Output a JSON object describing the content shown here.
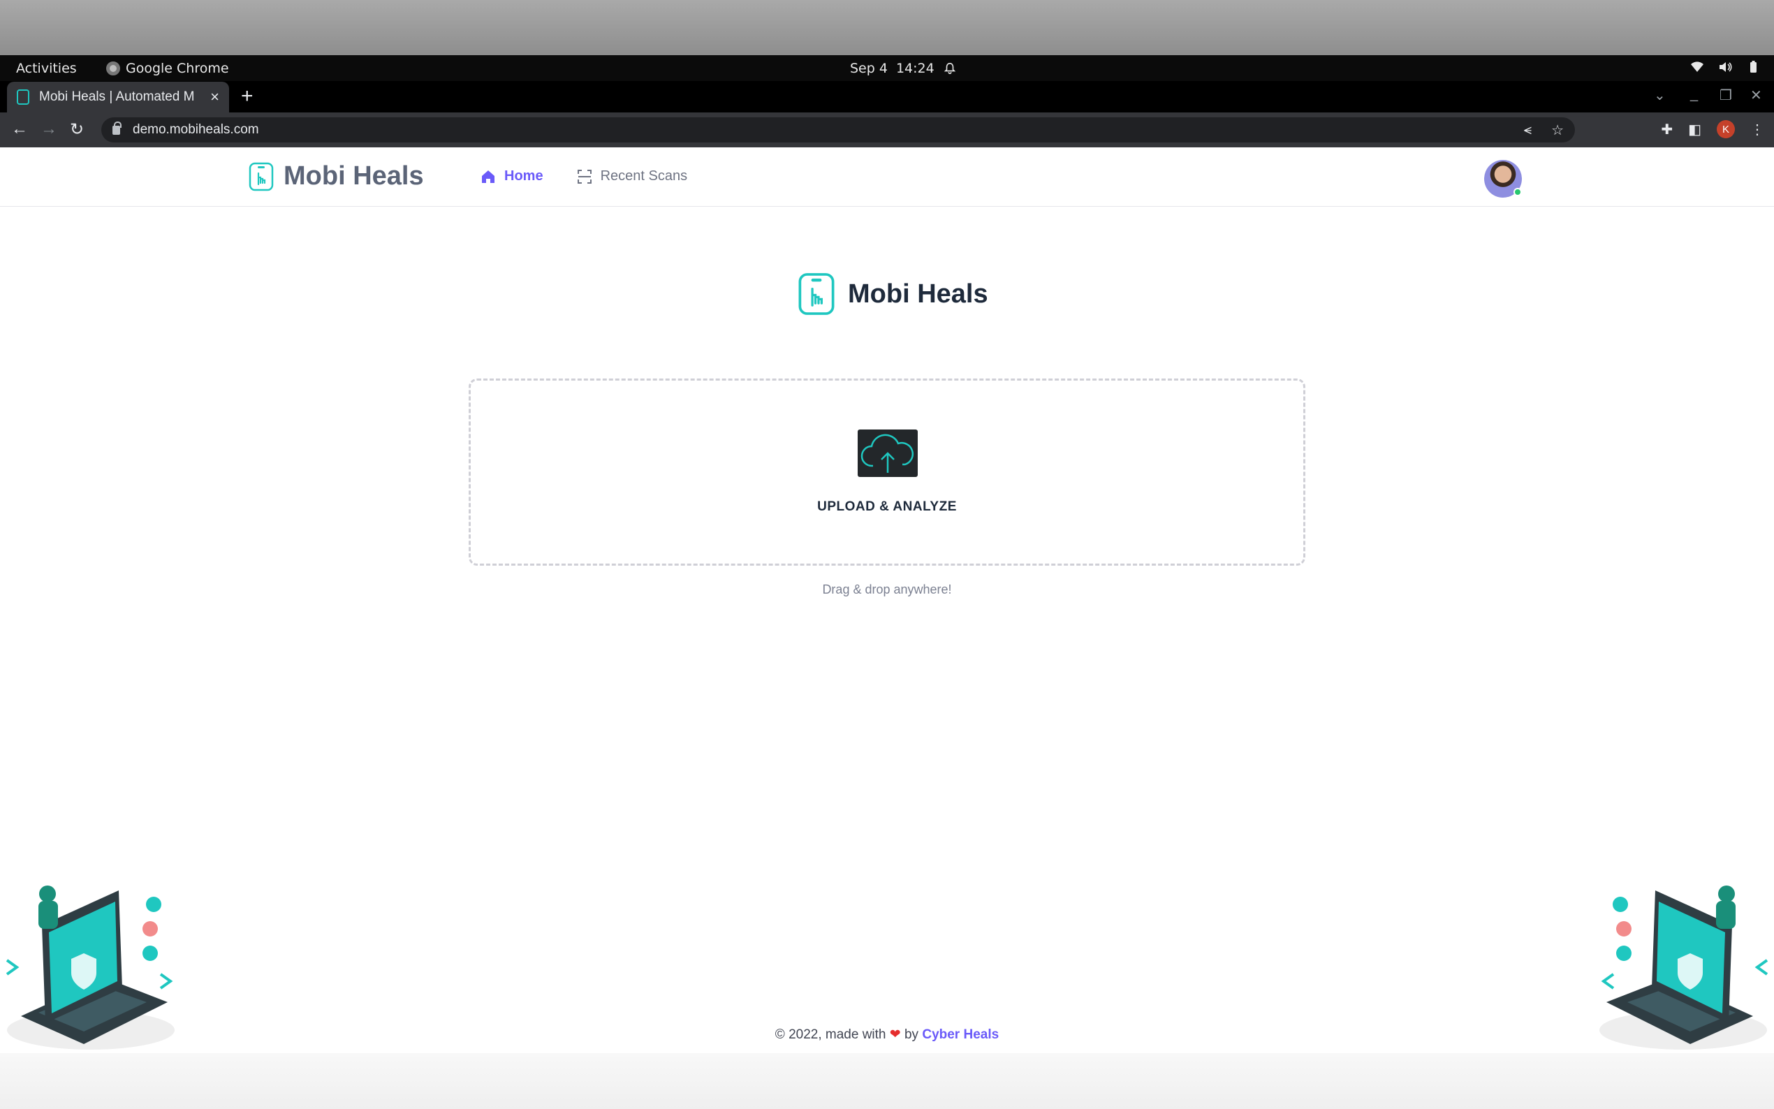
{
  "desktop": {
    "activities": "Activities",
    "app_name": "Google Chrome",
    "date": "Sep 4",
    "time": "14:24"
  },
  "browser": {
    "tab_title": "Mobi Heals | Automated M",
    "url": "demo.mobiheals.com",
    "profile_initial": "K"
  },
  "header": {
    "brand": "Mobi Heals",
    "nav": [
      {
        "label": "Home",
        "active": true
      },
      {
        "label": "Recent Scans",
        "active": false
      }
    ]
  },
  "main": {
    "logo_text": "Mobi Heals",
    "upload_label": "UPLOAD & ANALYZE",
    "hint": "Drag & drop anywhere!"
  },
  "footer": {
    "prefix": "© 2022, made with",
    "by": "by",
    "link": "Cyber Heals"
  },
  "colors": {
    "accent": "#6a5af9",
    "brand_teal": "#1fc7c0",
    "heart": "#e52d2d"
  },
  "icons": [
    "home-icon",
    "scan-icon",
    "upload-cloud-icon",
    "mobiheals-logo-icon",
    "lock-icon",
    "bell-icon",
    "wifi-icon",
    "volume-icon",
    "battery-icon"
  ]
}
